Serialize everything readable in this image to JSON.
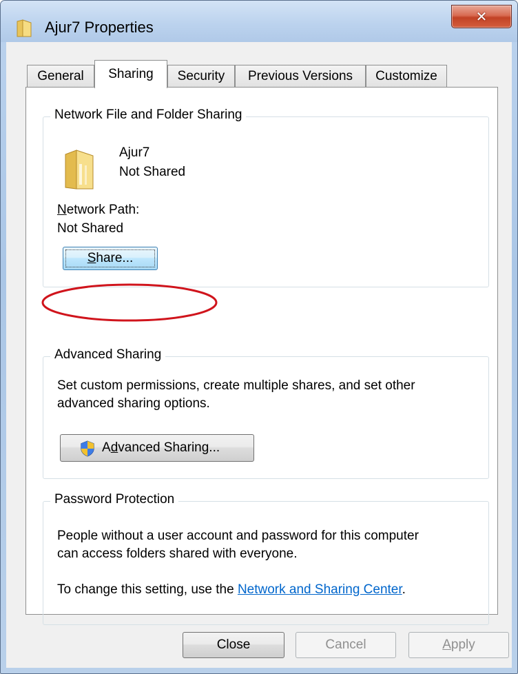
{
  "window": {
    "title": "Ajur7 Properties"
  },
  "tabs": [
    {
      "label": "General",
      "active": false
    },
    {
      "label": "Sharing",
      "active": true
    },
    {
      "label": "Security",
      "active": false
    },
    {
      "label": "Previous Versions",
      "active": false
    },
    {
      "label": "Customize",
      "active": false
    }
  ],
  "network_sharing": {
    "legend": "Network File and Folder Sharing",
    "folder_name": "Ajur7",
    "status": "Not Shared",
    "path_label_underlined": "N",
    "path_label_rest": "etwork Path:",
    "path_value": "Not Shared",
    "share_button_underlined": "S",
    "share_button_rest": "hare..."
  },
  "advanced_sharing": {
    "legend": "Advanced Sharing",
    "description_line1": "Set custom permissions, create multiple shares, and set other",
    "description_line2": "advanced sharing options.",
    "button_pre": "A",
    "button_underlined": "d",
    "button_rest": "vanced Sharing..."
  },
  "password_protection": {
    "legend": "Password Protection",
    "line1": "People without a user account and password for this computer",
    "line2": "can access folders shared with everyone.",
    "change_prefix": "To change this setting, use the ",
    "link_text": "Network and Sharing Center",
    "change_suffix": "."
  },
  "footer": {
    "close_label": "Close",
    "cancel_label": "Cancel",
    "apply_underlined": "A",
    "apply_rest": "pply"
  },
  "colors": {
    "annotation_ellipse": "#d0141c",
    "link": "#0066cc",
    "title_close_button": "#c24225"
  },
  "icons": {
    "title": "folder-icon",
    "folder": "folder-icon",
    "advanced_button": "uac-shield-icon",
    "close_window": "close-icon"
  }
}
